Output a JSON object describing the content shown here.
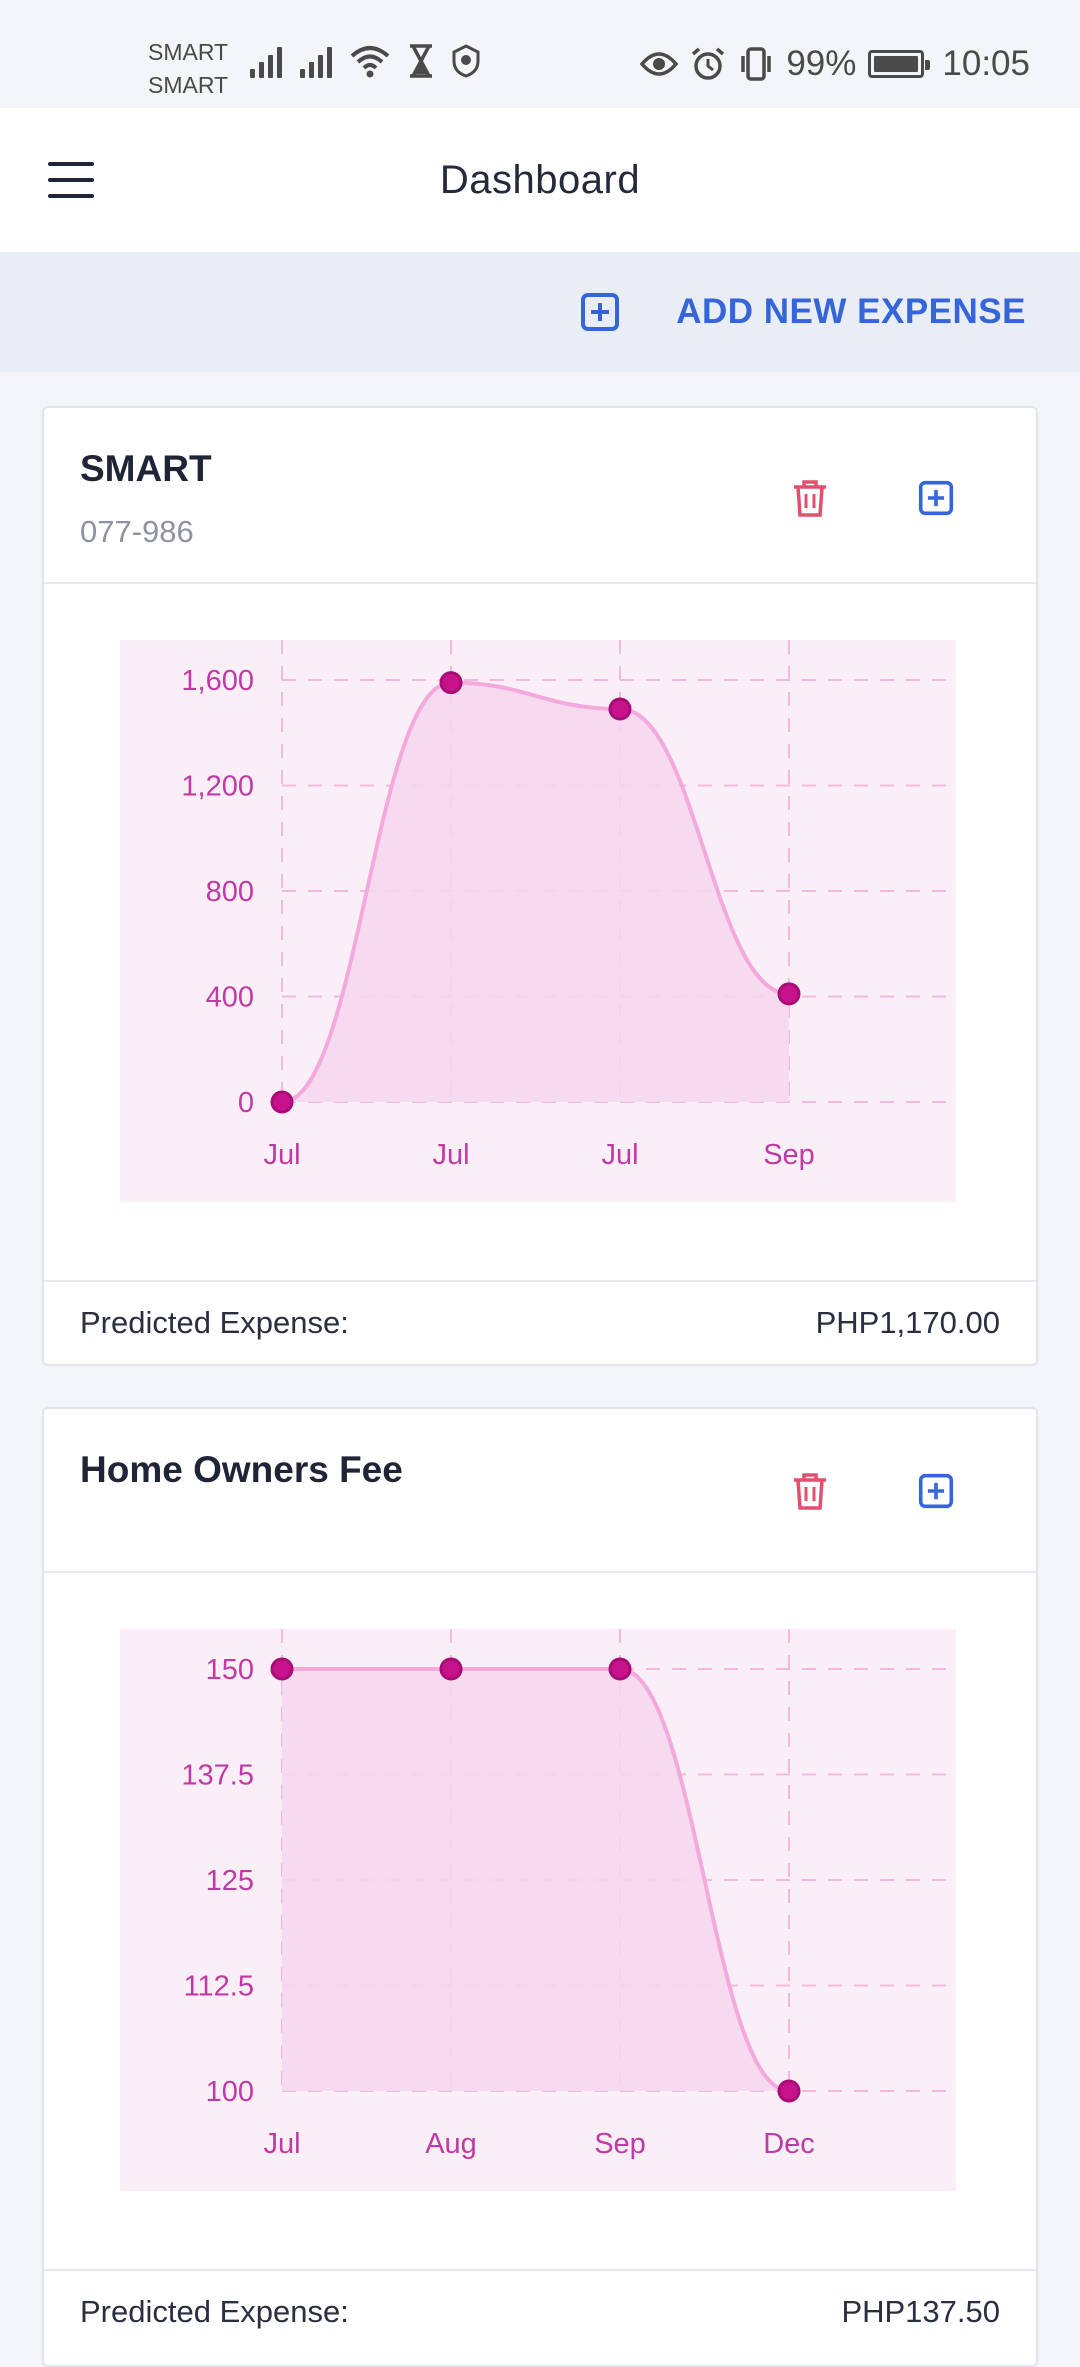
{
  "status_bar": {
    "carrier_1": "SMART",
    "carrier_2": "SMART",
    "battery": "99%",
    "time": "10:05",
    "icons": [
      "signal-icon",
      "signal-icon",
      "wifi-icon",
      "hourglass-icon",
      "vpn-icon",
      "eye-icon",
      "alarm-icon",
      "vibrate-icon",
      "battery-icon"
    ]
  },
  "app_bar": {
    "title": "Dashboard",
    "menu_icon": "hamburger-menu-icon"
  },
  "action_bar": {
    "add_label": "ADD NEW EXPENSE",
    "add_icon": "plus-square-icon"
  },
  "colors": {
    "accent": "#3565d8",
    "delete": "#e2506f",
    "chart_line": "#f4a9dc",
    "chart_point": "#c7128c",
    "chart_fill": "#f5d8ee",
    "chart_bg": "#fbeff7",
    "chart_text": "#c03aa5"
  },
  "cards": [
    {
      "title": "SMART",
      "subtitle": "077-986",
      "footer_label": "Predicted Expense:",
      "footer_value": "PHP1,170.00",
      "chart_data": {
        "type": "area",
        "categories": [
          "Jul",
          "Jul",
          "Jul",
          "Sep"
        ],
        "values": [
          0,
          1590,
          1490,
          410
        ],
        "yticks": [
          0,
          400,
          800,
          1200,
          1600
        ],
        "ytick_labels": [
          "0",
          "400",
          "800",
          "1,200",
          "1,600"
        ],
        "ylim": [
          0,
          1700
        ],
        "grid": true,
        "legend": "none"
      }
    },
    {
      "title": "Home Owners Fee",
      "subtitle": "",
      "footer_label": "Predicted Expense:",
      "footer_value": "PHP137.50",
      "chart_data": {
        "type": "area",
        "categories": [
          "Jul",
          "Aug",
          "Sep",
          "Dec"
        ],
        "values": [
          150,
          150,
          150,
          100
        ],
        "yticks": [
          100,
          112.5,
          125,
          137.5,
          150
        ],
        "ytick_labels": [
          "100",
          "112.5",
          "125",
          "137.5",
          "150"
        ],
        "ylim": [
          100,
          150
        ],
        "grid": true,
        "legend": "none"
      }
    }
  ]
}
